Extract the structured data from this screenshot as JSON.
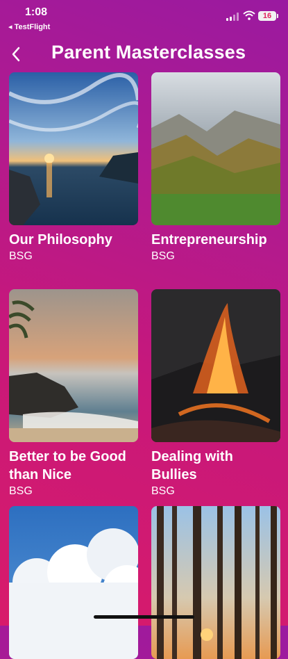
{
  "status": {
    "time": "1:08",
    "back_app": "◂ TestFlight",
    "battery": "16"
  },
  "nav": {
    "back_icon": "chevron-left-icon",
    "title": "Parent Masterclasses"
  },
  "cards": [
    {
      "title": "Our Philosophy",
      "subtitle": "BSG",
      "image": "sunset-sea-cliffs"
    },
    {
      "title": "Entrepreneurship",
      "subtitle": "BSG",
      "image": "misty-mountain-valley"
    },
    {
      "title": "Better to be Good than Nice",
      "subtitle": "BSG",
      "image": "tropical-beach-rocks"
    },
    {
      "title": "Dealing with Bullies",
      "subtitle": "BSG",
      "image": "erupting-volcano"
    },
    {
      "title": "",
      "subtitle": "",
      "image": "blue-sky-clouds"
    },
    {
      "title": "",
      "subtitle": "",
      "image": "forest-sunrise-trees"
    }
  ],
  "colors": {
    "bg_top": "#9a1aa0",
    "bg_bottom": "#d81b6a"
  }
}
